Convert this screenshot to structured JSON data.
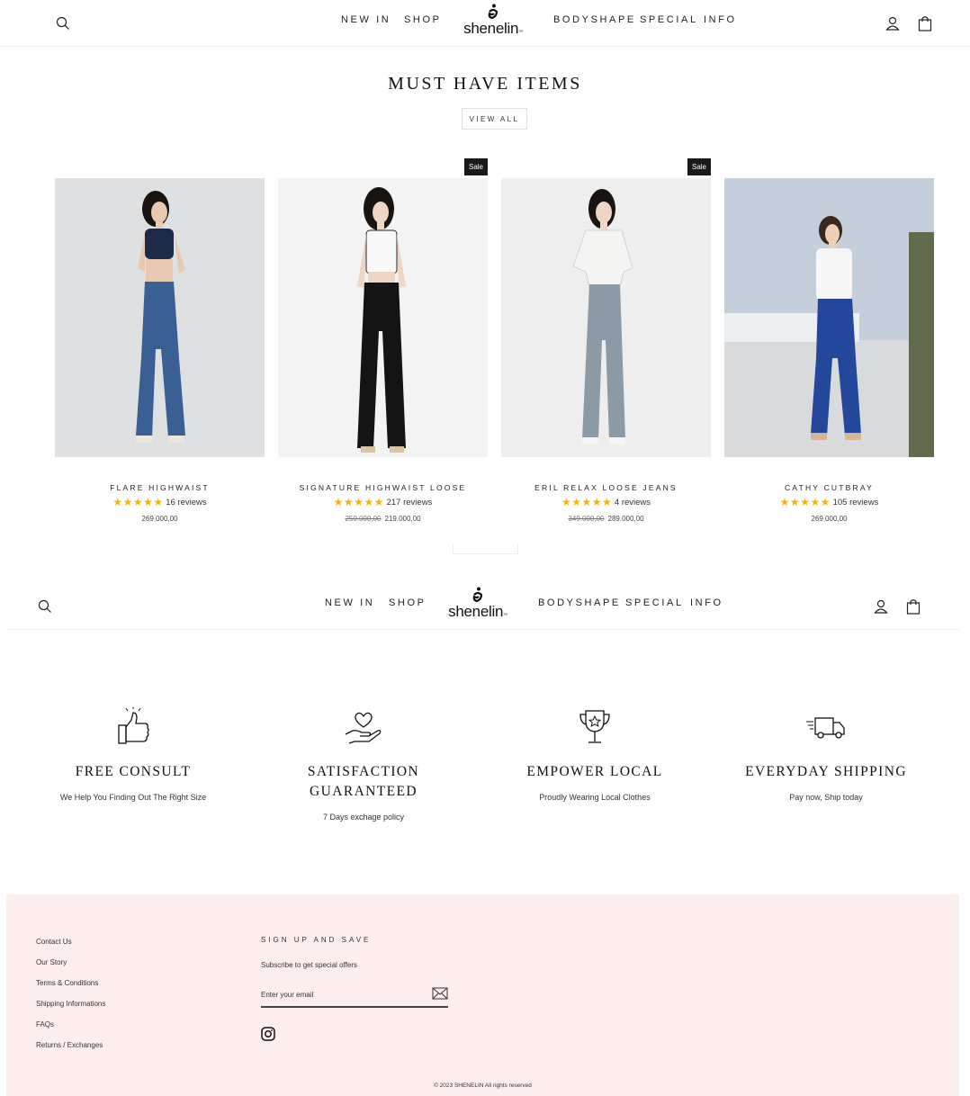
{
  "header": {
    "nav_left": [
      "NEW IN",
      "SHOP"
    ],
    "nav_right": [
      "BODYSHAPE",
      "SPECIAL",
      "INFO"
    ],
    "logo_text": "shenelin",
    "logo_tm": "™"
  },
  "must_have": {
    "title": "MUST HAVE ITEMS",
    "view_all": "VIEW ALL",
    "products": [
      {
        "name": "FLARE HIGHWAIST",
        "stars": "★★★★★",
        "reviews": "16 reviews",
        "price": "269.000,00",
        "old_price": "",
        "badge": "",
        "rating": 5
      },
      {
        "name": "SIGNATURE HIGHWAIST LOOSE",
        "stars": "★★★★★",
        "reviews": "217 reviews",
        "price": "219.000,00",
        "old_price": "250.000,00",
        "badge": "Sale",
        "rating": 5
      },
      {
        "name": "ERIL RELAX LOOSE JEANS",
        "stars": "★★★★★",
        "reviews": "4 reviews",
        "price": "289.000,00",
        "old_price": "349.000,00",
        "badge": "Sale",
        "rating": 5
      },
      {
        "name": "CATHY CUTBRAY",
        "stars": "★★★★★",
        "reviews": "105 reviews",
        "price": "269.000,00",
        "old_price": "",
        "badge": "",
        "rating": 5
      }
    ]
  },
  "features": [
    {
      "icon": "thumbs-up-icon",
      "title": "FREE CONSULT",
      "subtitle": "We Help You Finding Out The Right Size"
    },
    {
      "icon": "heart-hand-icon",
      "title": "SATISFACTION GUARANTEED",
      "subtitle": "7 Days exchage policy"
    },
    {
      "icon": "trophy-icon",
      "title": "EMPOWER LOCAL",
      "subtitle": "Proudly Wearing Local Clothes"
    },
    {
      "icon": "delivery-truck-icon",
      "title": "EVERYDAY SHIPPING",
      "subtitle": "Pay now, Ship today"
    }
  ],
  "footer": {
    "links": [
      "Contact Us",
      "Our Story",
      "Terms & Conditions",
      "Shipping Informations",
      "FAQs",
      "Returns / Exchanges"
    ],
    "signup_title": "SIGN UP AND SAVE",
    "signup_subtitle": "Subscribe to get special offers",
    "email_placeholder": "Enter your email",
    "copyright": "© 2023 SHENELIN All rights reserved"
  },
  "colors": {
    "star": "#f6b600",
    "footer_bg": "#fdeeee",
    "badge_bg": "#1a1a1a"
  }
}
